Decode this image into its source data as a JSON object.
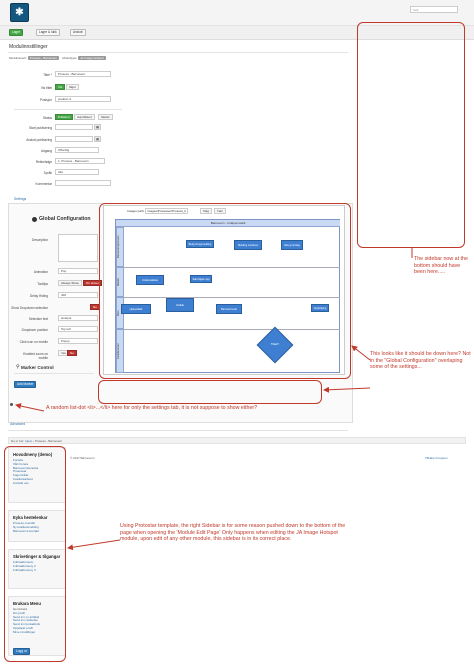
{
  "header": {
    "search_placeholder": "Søk"
  },
  "toolbar": {
    "save": "Lagre",
    "save_close": "Lagre & lukk",
    "close": "Avslutt"
  },
  "page": {
    "title": "Modulinnstillinger"
  },
  "crumbs": {
    "site_label": "Modulinnavn:",
    "site_value": "Prosess - Barnevern",
    "type_label": "Modultype:",
    "type_value": "JA Image Hotspot"
  },
  "form": {
    "title_label": "Tittel *",
    "title_value": "Prosess - Barnevern",
    "show_title_label": "Vis tittel",
    "show_yes": "Vis",
    "show_no": "Skjul",
    "position_label": "Posisjon",
    "position_value": "position-3",
    "status_label": "Status",
    "status_published": "Publisert",
    "status_unpublished": "Avpublisert",
    "status_trashed": "Slettet",
    "start_label": "Start publisering",
    "end_label": "Avslutt publisering",
    "access_label": "Adgang",
    "access_value": "Offentlig",
    "order_label": "Rekkefølge",
    "order_value": "1. Prosess - Barnevern",
    "language_label": "Språk",
    "language_value": "Alle",
    "note_label": "Kommentar"
  },
  "tabs": {
    "settings": "Settings",
    "advanced": "Advanced"
  },
  "settings": {
    "global_title": "Global Configuration",
    "description_label": "Description",
    "animation_label": "Animation",
    "animation_value": "Pop",
    "tooltips_label": "Tooltips",
    "tooltips_always": "Always Show",
    "tooltips_hover": "On Hover",
    "delay_label": "Delay Hiding",
    "delay_value": "400",
    "dropdown_label": "Show Dropdown selection",
    "dropdown_no": "No",
    "selection_label": "Selection text",
    "selection_value": "Hotspot",
    "position_label": "Dropdown position",
    "position_value": "Top left",
    "click_label": "Click icon on mobile",
    "click_value": "Popup",
    "zoom_label": "Enabled zoom on mobile",
    "zoom_yes": "Yes",
    "zoom_no": "No",
    "marker_control": "Marker Control",
    "add_marker": "Add Marker"
  },
  "diagram": {
    "path_label": "Images path:",
    "path_value": "images/Prosesser/Prosess_b",
    "btn_velg": "Velg",
    "btn_tom": "Tøm",
    "header": "Barnevern - forløpsmodell",
    "lanes": [
      "Barneverntjenesten",
      "Melder",
      "Barn",
      "Familievernet"
    ],
    "boxes": [
      "Bekymringsmelding",
      "Melding vurderes",
      "Ikke grunnlag",
      "Undersøkelse",
      "Sak følges opp",
      "Hjelpetiltak",
      "Vedtak",
      "Barnets beste",
      "Oppfølging"
    ],
    "decision": "Tiltak?"
  },
  "annotations": {
    "sidebar": "The sidebar now at the bottom should have been here.....",
    "global": "This looks like it should be down here? Not in the \"Global Configuration\" overlaping some of the settings...",
    "listdot": "A random list-dot <li>...</li> here for only the settings tab, it is not suppose to show either?",
    "protostar": "Using Protostar template, the right Sidebar is for some reason pushed down to the bottom of the page when opening the 'Module Edit Page' Only happens when editing the JA Image Hotspot module, upon edit of any other module, this sidebar is in its correct place."
  },
  "footer": {
    "breadcrumb_you": "Du er her:",
    "breadcrumb_home": "Hjem",
    "breadcrumb_sep": "Prosess - Barnevern",
    "back_to_top": "Tilbake til toppen",
    "copyright": "© 2017 Barnevern"
  },
  "sidebar": {
    "main_menu_title": "Hovudmeny (demo)",
    "main_menu_items": [
      "Forsida",
      "Vårt Foreta",
      "Barnevernstenesta",
      "Prosessar",
      "Fagområde",
      "Kvalitetsarbeid",
      "Kontakt oss"
    ],
    "quick_title": "Eyka hentelenkar",
    "quick_items": [
      "Prosess oversikt",
      "Ny kvalitetsmelding",
      "Barneverns kontakt"
    ],
    "writing_title": "Skrivetinger & tilgangar",
    "writing_items": [
      "Fullmaktsmenu",
      "Fullmaktsmeny 2",
      "Fullmaktsmeny 3"
    ],
    "user_title": "Brukara Menu",
    "user_greeting": "Hei Arbeid,",
    "user_items": [
      "Din profil",
      "Send inn ny artikkel",
      "Send inn nettlenke",
      "Send inn kontaktinfo",
      "Oppdater profil",
      "Mine innstillinger"
    ],
    "logout": "Logg ut"
  }
}
